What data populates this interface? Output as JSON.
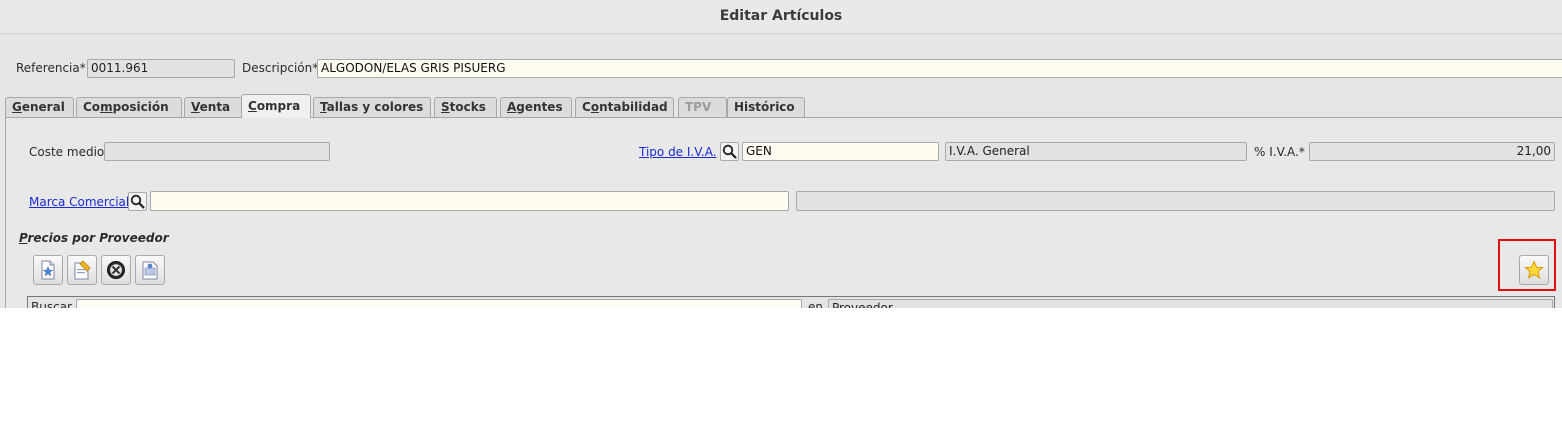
{
  "window": {
    "title": "Editar Artículos"
  },
  "header": {
    "referencia_label": "Referencia*",
    "referencia_value": "0011.961",
    "descripcion_label": "Descripción*",
    "descripcion_value": "ALGODON/ELAS GRIS PISUERG"
  },
  "tabs": [
    {
      "label": "General",
      "accel": "G",
      "rest": "eneral",
      "state": "normal"
    },
    {
      "label": "Composición",
      "pre": "Co",
      "accel": "m",
      "rest": "posición",
      "state": "normal"
    },
    {
      "label": "Venta",
      "accel": "V",
      "rest": "enta",
      "state": "normal"
    },
    {
      "label": "Compra",
      "accel": "C",
      "rest": "ompra",
      "state": "active"
    },
    {
      "label": "Tallas y colores",
      "accel": "T",
      "rest": "allas y colores",
      "state": "normal"
    },
    {
      "label": "Stocks",
      "accel": "S",
      "rest": "tocks",
      "state": "normal"
    },
    {
      "label": "Agentes",
      "accel": "A",
      "rest": "gentes",
      "state": "normal"
    },
    {
      "label": "Contabilidad",
      "pre": "C",
      "accel": "o",
      "rest": "ntabilidad",
      "state": "normal"
    },
    {
      "label": "TPV",
      "state": "disabled"
    },
    {
      "label": "Histórico",
      "state": "normal"
    }
  ],
  "compra": {
    "coste_medio_label": "Coste medio",
    "coste_medio_value": "",
    "tipo_iva_link": "Tipo de I.V.A.",
    "tipo_iva_code": "GEN",
    "tipo_iva_desc": "I.V.A. General",
    "pct_iva_label": "% I.V.A.*",
    "pct_iva_value": "21,00",
    "marca_link": "Marca Comercial",
    "marca_code": "",
    "marca_desc": ""
  },
  "precios": {
    "section_title": "Precios por Proveedor",
    "section_accel": "P",
    "section_rest": "recios por Proveedor",
    "toolbar": [
      "new-record-icon",
      "edit-record-icon",
      "delete-record-icon",
      "view-record-icon"
    ],
    "favorite": "favorite-star-icon",
    "search_label": "Buscar",
    "search_value": "",
    "search_in_label": "en",
    "search_field_selected": "Proveedor"
  },
  "colors": {
    "highlight": "#e01010",
    "link": "#1a2bd1",
    "editable_bg": "#fffdf2"
  }
}
